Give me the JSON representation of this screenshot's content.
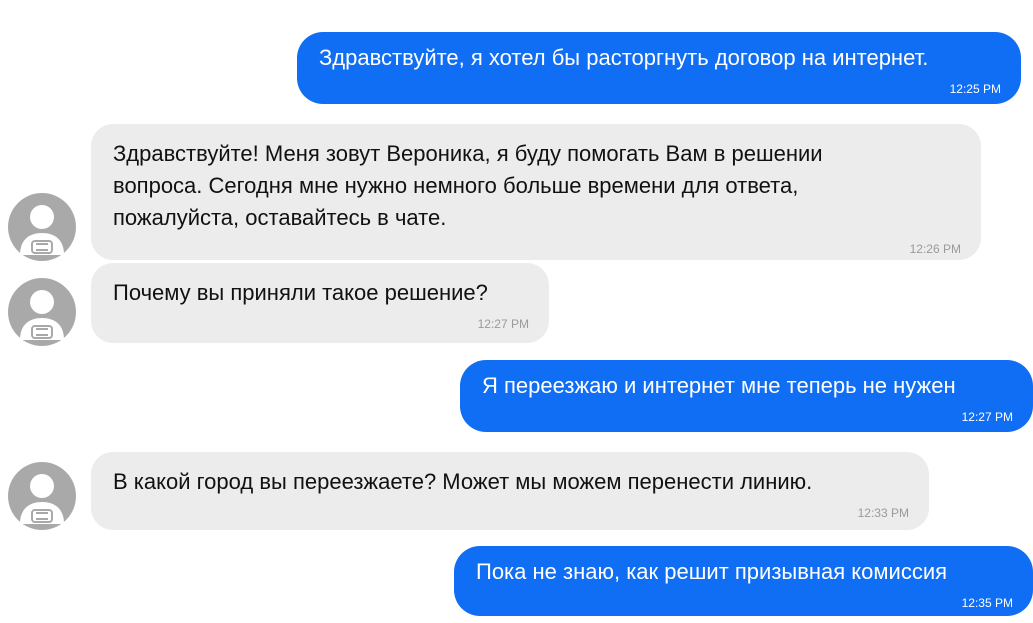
{
  "messages": [
    {
      "direction": "outgoing",
      "text": "Здравствуйте, я хотел бы расторгнуть договор на интернет.",
      "time": "12:25 PM"
    },
    {
      "direction": "incoming",
      "text": "Здравствуйте! Меня зовут Вероника, я буду помогать Вам в решении\nвопроса. Сегодня мне нужно немного больше времени для ответа,\nпожалуйста, оставайтесь в чате.",
      "time": "12:26 PM"
    },
    {
      "direction": "incoming",
      "text": "Почему вы приняли такое решение?",
      "time": "12:27 PM"
    },
    {
      "direction": "outgoing",
      "text": "Я переезжаю и интернет мне теперь не нужен",
      "time": "12:27 PM"
    },
    {
      "direction": "incoming",
      "text": "В какой город вы переезжаете? Может мы можем перенести линию.",
      "time": "12:33 PM"
    },
    {
      "direction": "outgoing",
      "text": "Пока не знаю, как решит призывная комиссия",
      "time": "12:35 PM"
    }
  ],
  "colors": {
    "outgoing_bubble": "#0f6ef3",
    "incoming_bubble": "#ececec",
    "avatar": "#a9a9a9"
  },
  "icons": {
    "agent_avatar": "user-avatar-icon"
  }
}
